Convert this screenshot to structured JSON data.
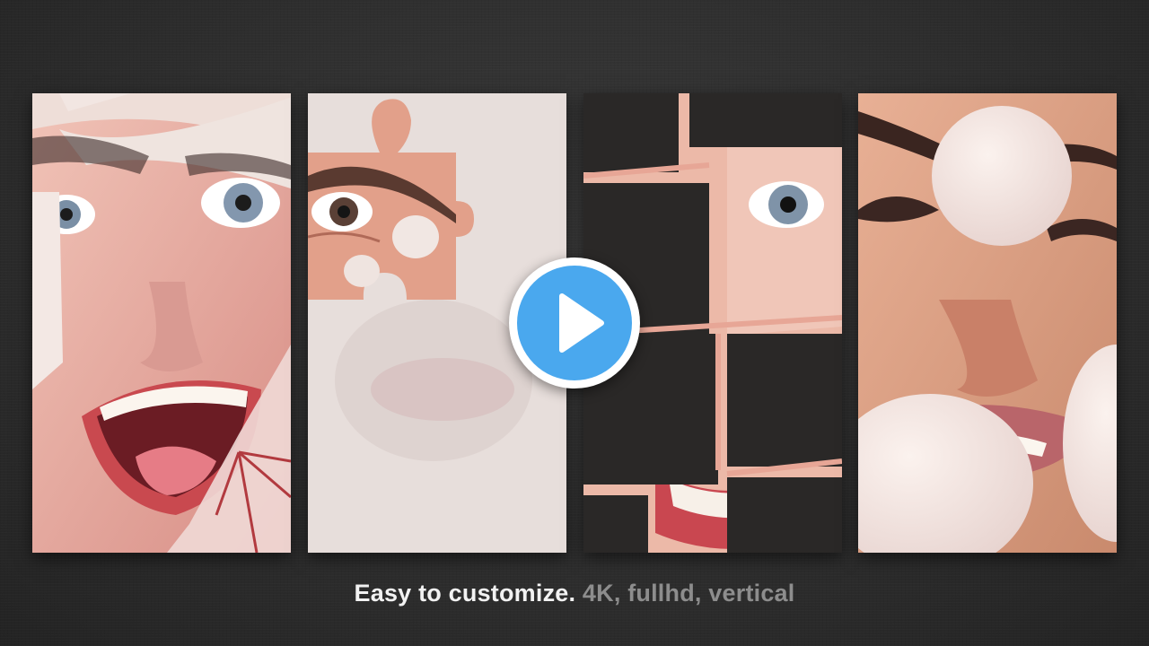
{
  "video": {
    "caption_primary": "Easy to  customize.",
    "caption_secondary": "4K, fullhd, vertical",
    "play_button": {
      "icon": "play-icon",
      "color": "#4aa8ee"
    }
  },
  "panels": [
    {
      "name": "face-photo-shattered-transition"
    },
    {
      "name": "face-photo-puzzle-piece-transition"
    },
    {
      "name": "face-photo-dark-tiles-transition"
    },
    {
      "name": "face-photo-bubble-transition"
    }
  ]
}
